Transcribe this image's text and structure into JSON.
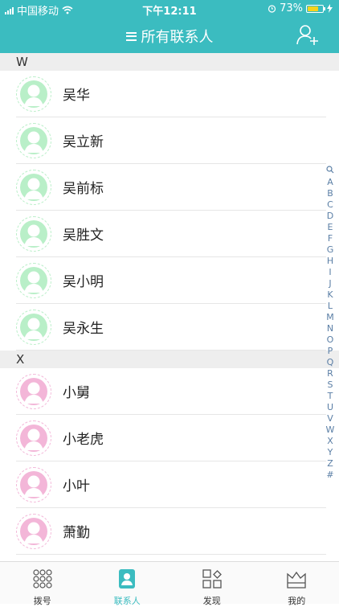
{
  "status": {
    "carrier": "中国移动",
    "time": "下午12:11",
    "battery_percent": "73%",
    "battery_level": 0.73
  },
  "header": {
    "title": "所有联系人",
    "add_icon": "add-contact-icon"
  },
  "colors": {
    "accent": "#3bbcc0",
    "avatar_green": "#b9efc8",
    "avatar_pink": "#f3b6d8"
  },
  "sections": [
    {
      "letter": "W",
      "contacts": [
        {
          "name": "吴华"
        },
        {
          "name": "吴立新"
        },
        {
          "name": "吴前标"
        },
        {
          "name": "吴胜文"
        },
        {
          "name": "吴小明"
        },
        {
          "name": "吴永生"
        }
      ]
    },
    {
      "letter": "X",
      "contacts": [
        {
          "name": "小舅"
        },
        {
          "name": "小老虎"
        },
        {
          "name": "小叶"
        },
        {
          "name": "萧勤"
        }
      ]
    }
  ],
  "index": [
    "A",
    "B",
    "C",
    "D",
    "E",
    "F",
    "G",
    "H",
    "I",
    "J",
    "K",
    "L",
    "M",
    "N",
    "O",
    "P",
    "Q",
    "R",
    "S",
    "T",
    "U",
    "V",
    "W",
    "X",
    "Y",
    "Z",
    "#"
  ],
  "tabs": [
    {
      "label": "拨号",
      "icon": "dialpad-icon"
    },
    {
      "label": "联系人",
      "icon": "contacts-icon"
    },
    {
      "label": "发现",
      "icon": "discover-icon"
    },
    {
      "label": "我的",
      "icon": "profile-icon"
    }
  ]
}
